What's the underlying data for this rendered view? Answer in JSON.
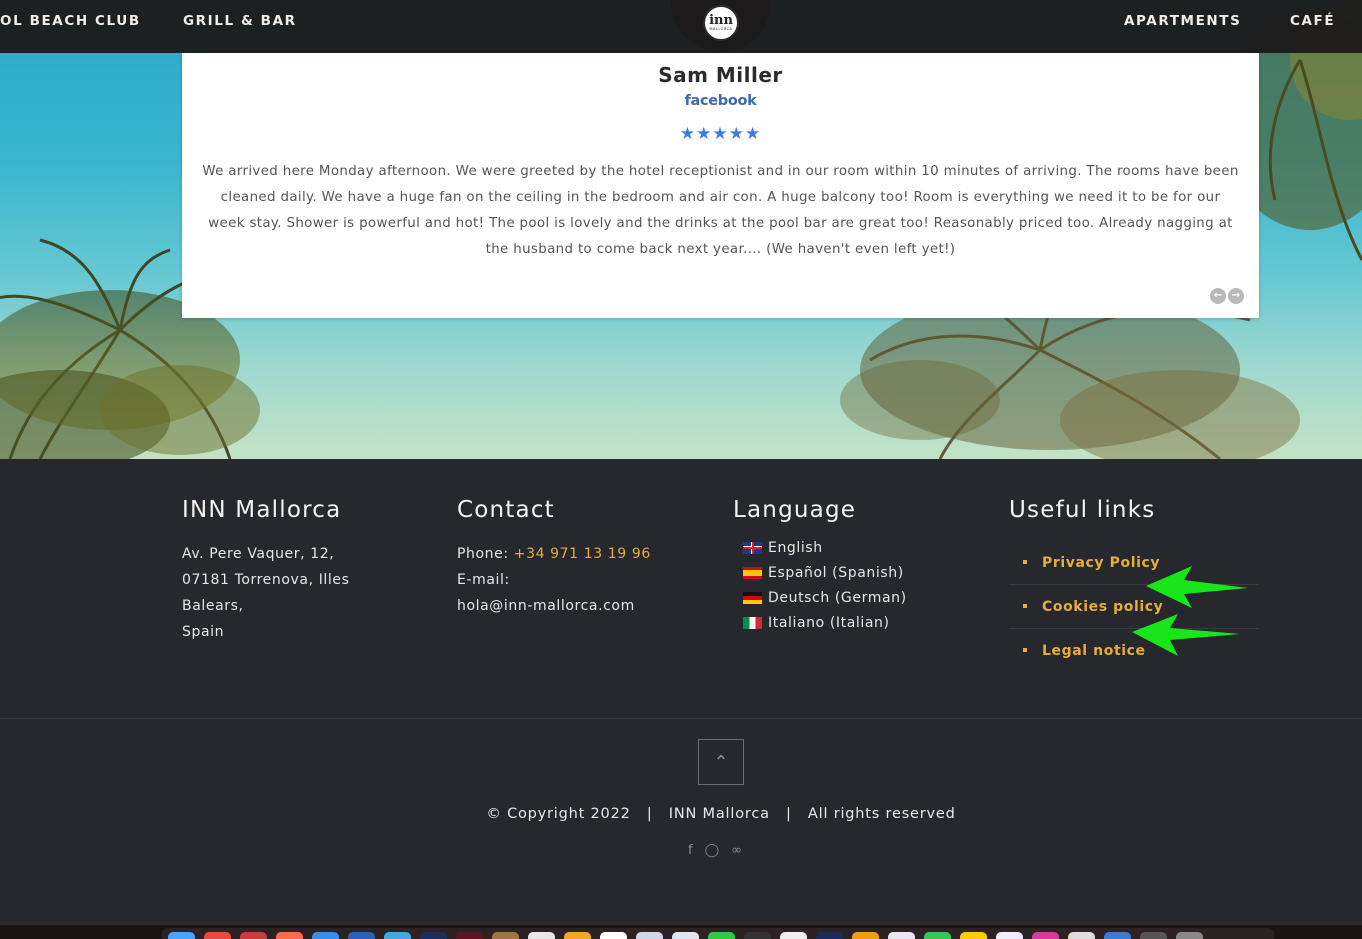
{
  "nav": {
    "left_items": [
      "OL BEACH CLUB",
      "GRILL & BAR"
    ],
    "right_items": [
      "APARTMENTS",
      "CAFÉ"
    ],
    "logo_text": "inn",
    "logo_subtext": "MALLORCA"
  },
  "review": {
    "name": "Sam Miller",
    "source": "facebook",
    "rating": 5,
    "stars": "★★★★★",
    "text": "We arrived here Monday afternoon. We were greeted by the hotel receptionist and in our room within 10 minutes of arriving. The rooms have been cleaned daily. We have a huge fan on the ceiling in the bedroom and air con. A huge balcony too! Room is everything we need it to be for our week stay. Shower is powerful and hot! The pool is lovely and the drinks at the pool bar are great too! Reasonably priced too. Already nagging at the husband to come back next year.... (We haven't even left yet!)",
    "prev_icon": "arrow-left-icon",
    "next_icon": "arrow-right-icon"
  },
  "footer": {
    "about": {
      "title": "INN Mallorca",
      "address_line1": "Av. Pere Vaquer, 12,",
      "address_line2": "07181 Torrenova, Illes",
      "address_line3": "Balears,",
      "address_line4": "Spain"
    },
    "contact": {
      "title": "Contact",
      "phone_label": "Phone: ",
      "phone_value": "+34 971 13 19 96",
      "email_label": "E-mail:",
      "email_value": "hola@inn-mallorca.com"
    },
    "language": {
      "title": "Language",
      "items": [
        "English",
        "Español (Spanish)",
        "Deutsch (German)",
        "Italiano (Italian)"
      ]
    },
    "useful_links": {
      "title": "Useful links",
      "items": [
        "Privacy Policy",
        "Cookies policy",
        "Legal notice"
      ]
    },
    "copyright": "© Copyright 2022   |   INN Mallorca   |   All rights reserved",
    "social_icons": [
      "facebook-icon",
      "instagram-icon",
      "tripadvisor-icon"
    ]
  },
  "colors": {
    "accent": "#e8ac3a",
    "footer_bg": "#26282d",
    "star": "#3f7ce0",
    "facebook": "#4267b2",
    "annotation_arrow": "#19e619"
  }
}
